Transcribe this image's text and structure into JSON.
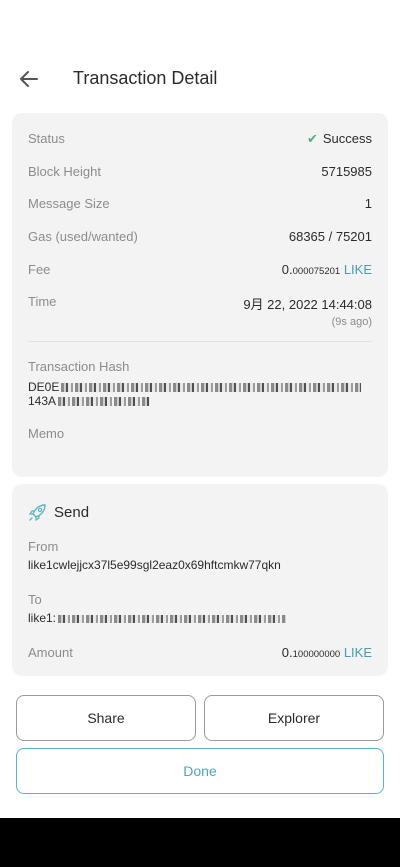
{
  "header": {
    "title": "Transaction Detail"
  },
  "details": {
    "status_label": "Status",
    "status_value": "Success",
    "block_label": "Block Height",
    "block_value": "5715985",
    "msgsize_label": "Message Size",
    "msgsize_value": "1",
    "gas_label": "Gas (used/wanted)",
    "gas_value": "68365 / 75201",
    "fee_label": "Fee",
    "fee_int": "0.",
    "fee_dec": "000075201",
    "fee_denom": "LIKE",
    "time_label": "Time",
    "time_value": "9月 22, 2022 14:44:08",
    "time_ago": "(9s ago)",
    "hash_label": "Transaction Hash",
    "hash_line1": "DE0E",
    "hash_line2": "143A",
    "memo_label": "Memo"
  },
  "send": {
    "title": "Send",
    "from_label": "From",
    "from_value": "like1cwlejjcx37l5e99sgl2eaz0x69hftcmkw77qkn",
    "to_label": "To",
    "to_value": "like1:",
    "amount_label": "Amount",
    "amount_int": "0.",
    "amount_dec": "100000000",
    "amount_denom": "LIKE"
  },
  "buttons": {
    "share": "Share",
    "explorer": "Explorer",
    "done": "Done"
  },
  "icons": {
    "back": "arrow-left-icon",
    "status": "check-icon",
    "send": "rocket-icon"
  },
  "colors": {
    "accent": "#4a9bb0",
    "success": "#50b07a",
    "card": "#f3f3f3"
  }
}
